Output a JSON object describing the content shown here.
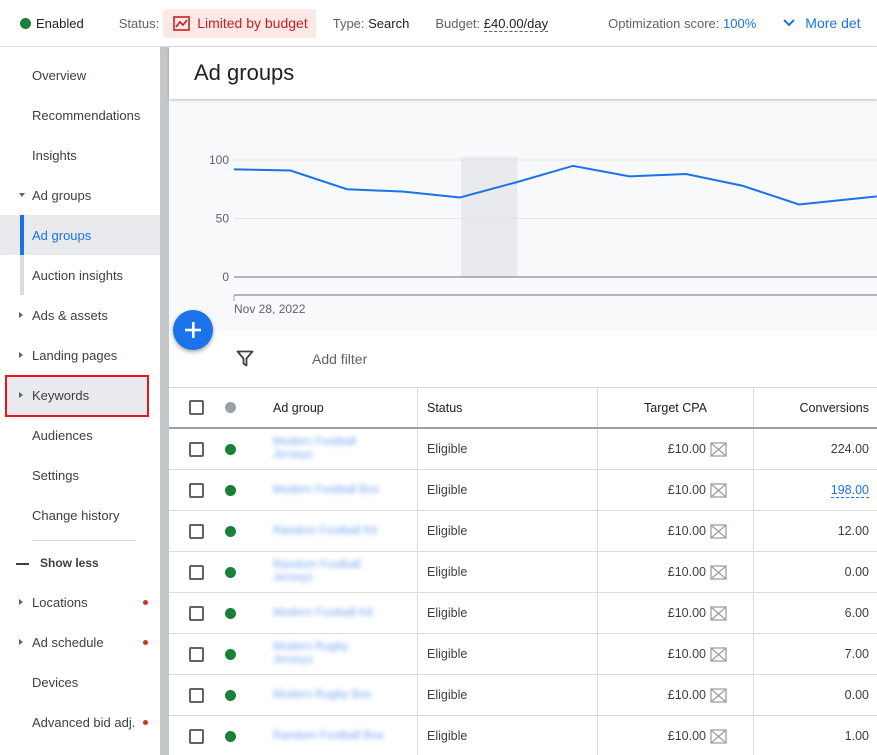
{
  "topbar": {
    "enabled_label": "Enabled",
    "status_label": "Status:",
    "status_value": "Limited by budget",
    "type_label": "Type:",
    "type_value": "Search",
    "budget_label": "Budget:",
    "budget_value": "£40.00/day",
    "opt_label": "Optimization score:",
    "opt_value": "100%",
    "more_label": "More det"
  },
  "sidebar": {
    "items": [
      {
        "label": "Overview"
      },
      {
        "label": "Recommendations"
      },
      {
        "label": "Insights"
      },
      {
        "label": "Ad groups"
      },
      {
        "label": "Ad groups"
      },
      {
        "label": "Auction insights"
      },
      {
        "label": "Ads & assets"
      },
      {
        "label": "Landing pages"
      },
      {
        "label": "Keywords"
      },
      {
        "label": "Audiences"
      },
      {
        "label": "Settings"
      },
      {
        "label": "Change history"
      },
      {
        "label": "Show less"
      },
      {
        "label": "Locations"
      },
      {
        "label": "Ad schedule"
      },
      {
        "label": "Devices"
      },
      {
        "label": "Advanced bid adj."
      }
    ]
  },
  "main": {
    "title": "Ad groups",
    "add_filter": "Add filter"
  },
  "chart_data": {
    "type": "line",
    "x_start_label": "Nov 28, 2022",
    "y_ticks": [
      0,
      50,
      100
    ],
    "ylim": [
      0,
      100
    ],
    "values": [
      92,
      91,
      75,
      73,
      68,
      81,
      95,
      86,
      88,
      78,
      62,
      67,
      72
    ],
    "grid": true,
    "highlight_index": 5
  },
  "table": {
    "headers": {
      "ad_group": "Ad group",
      "status": "Status",
      "target_cpa": "Target CPA",
      "conversions": "Conversions"
    },
    "rows": [
      {
        "name1": "Modern Football",
        "name2": "Jerseys",
        "status": "Eligible",
        "cpa": "£10.00",
        "conversions": "224.00"
      },
      {
        "name1": "Modern Football Box",
        "name2": "",
        "status": "Eligible",
        "cpa": "£10.00",
        "conversions": "198.00"
      },
      {
        "name1": "Random Football Kit",
        "name2": "",
        "status": "Eligible",
        "cpa": "£10.00",
        "conversions": "12.00"
      },
      {
        "name1": "Random Football",
        "name2": "Jerseys",
        "status": "Eligible",
        "cpa": "£10.00",
        "conversions": "0.00"
      },
      {
        "name1": "Modern Football Kit",
        "name2": "",
        "status": "Eligible",
        "cpa": "£10.00",
        "conversions": "6.00"
      },
      {
        "name1": "Modern Rugby",
        "name2": "Jerseys",
        "status": "Eligible",
        "cpa": "£10.00",
        "conversions": "7.00"
      },
      {
        "name1": "Modern Rugby Box",
        "name2": "",
        "status": "Eligible",
        "cpa": "£10.00",
        "conversions": "0.00"
      },
      {
        "name1": "Random Football Box",
        "name2": "",
        "status": "Eligible",
        "cpa": "£10.00",
        "conversions": "1.00"
      }
    ]
  },
  "colors": {
    "accent": "#1a73e8",
    "enabled_green": "#188038",
    "limited_red": "#c5221f",
    "limited_bg": "#fce8e6",
    "highlight_red": "#e8151b"
  }
}
